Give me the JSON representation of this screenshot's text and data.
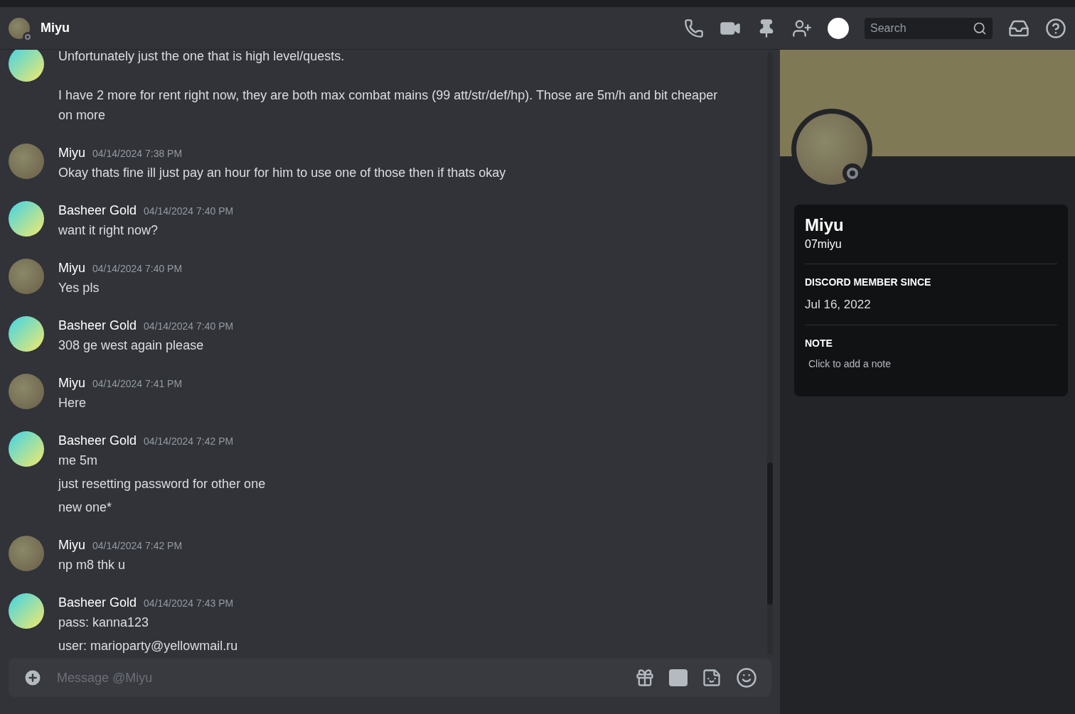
{
  "header": {
    "title": "Miyu",
    "search": {
      "placeholder": "Search"
    }
  },
  "messages": [
    {
      "kind": "gold",
      "paragraph_break": true,
      "lines": [
        "Unfortunately just the one that is high level/quests.",
        "I have 2 more for rent right now, they are both max combat mains (99 att/str/def/hp).  Those are 5m/h and bit cheaper on more"
      ]
    },
    {
      "kind": "photo",
      "author": "Miyu",
      "time": "04/14/2024 7:38 PM",
      "lines": [
        "Okay thats fine ill just pay an hour for him to use one of those then if thats okay"
      ]
    },
    {
      "kind": "gold",
      "author": "Basheer Gold",
      "time": "04/14/2024 7:40 PM",
      "lines": [
        "want it right now?"
      ]
    },
    {
      "kind": "photo",
      "author": "Miyu",
      "time": "04/14/2024 7:40 PM",
      "lines": [
        "Yes pls"
      ]
    },
    {
      "kind": "gold",
      "author": "Basheer Gold",
      "time": "04/14/2024 7:40 PM",
      "lines": [
        "308 ge west again please"
      ]
    },
    {
      "kind": "photo",
      "author": "Miyu",
      "time": "04/14/2024 7:41 PM",
      "lines": [
        "Here"
      ]
    },
    {
      "kind": "gold",
      "author": "Basheer Gold",
      "time": "04/14/2024 7:42 PM",
      "lines": [
        "me 5m",
        "just resetting password for other one",
        "new one*"
      ]
    },
    {
      "kind": "photo",
      "author": "Miyu",
      "time": "04/14/2024 7:42 PM",
      "lines": [
        "np m8 thk u"
      ]
    },
    {
      "kind": "gold",
      "author": "Basheer Gold",
      "time": "04/14/2024 7:43 PM",
      "lines": [
        "pass: kanna123",
        "user: marioparty@yellowmail.ru"
      ]
    }
  ],
  "composer": {
    "placeholder": "Message @Miyu"
  },
  "profile": {
    "display_name": "Miyu",
    "username": "07miyu",
    "member_since_label": "DISCORD MEMBER SINCE",
    "member_since": "Jul 16, 2022",
    "note_label": "NOTE",
    "note_placeholder": "Click to add a note"
  }
}
